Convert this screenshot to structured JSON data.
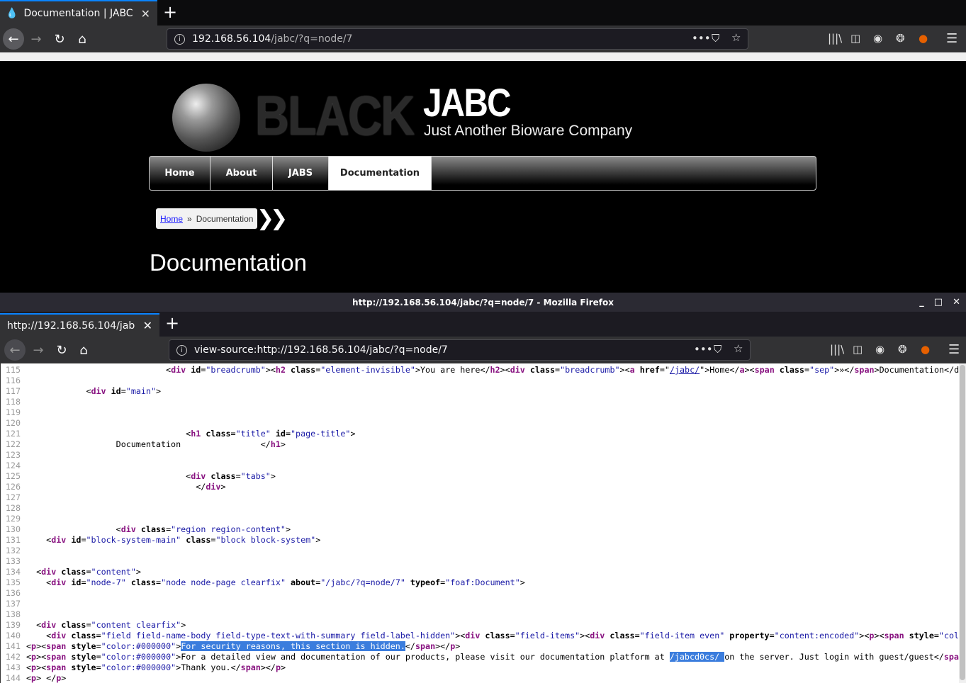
{
  "browser1": {
    "tab_title": "Documentation | JABC",
    "url_host": "192.168.56.104",
    "url_path": "/jabc/?q=node/7"
  },
  "site": {
    "logo_word": "BLACK",
    "name": "JABC",
    "slogan": "Just Another Bioware Company",
    "menu": [
      {
        "label": "Home",
        "active": false
      },
      {
        "label": "About",
        "active": false
      },
      {
        "label": "JABS",
        "active": false
      },
      {
        "label": "Documentation",
        "active": true
      }
    ],
    "breadcrumb": {
      "home": "Home",
      "sep": "»",
      "current": "Documentation"
    },
    "page_title": "Documentation"
  },
  "browser2": {
    "window_title": "http://192.168.56.104/jabc/?q=node/7 - Mozilla Firefox",
    "tab_title": "http://192.168.56.104/jabc/?",
    "url": "view-source:http://192.168.56.104/jabc/?q=node/7"
  },
  "icons": [
    "back-icon",
    "forward-icon",
    "reload-icon",
    "home-icon",
    "info-icon",
    "more-icon",
    "pocket-icon",
    "bookmark-star-icon",
    "library-icon",
    "sidebar-icon",
    "account-icon",
    "cookie-icon",
    "extension-icon",
    "hamburger-menu-icon"
  ],
  "source_lines": [
    {
      "n": "115",
      "tokens": [
        [
          "x",
          "                            <"
        ],
        [
          "t",
          "div"
        ],
        [
          "a",
          " id"
        ],
        [
          "x",
          "="
        ],
        [
          "v",
          "\"breadcrumb\""
        ],
        [
          "x",
          ">"
        ],
        [
          "x",
          "<"
        ],
        [
          "t",
          "h2"
        ],
        [
          "a",
          " class"
        ],
        [
          "x",
          "="
        ],
        [
          "v",
          "\"element-invisible\""
        ],
        [
          "x",
          ">You are here</"
        ],
        [
          "t",
          "h2"
        ],
        [
          "x",
          "><"
        ],
        [
          "t",
          "div"
        ],
        [
          "a",
          " class"
        ],
        [
          "x",
          "="
        ],
        [
          "v",
          "\"breadcrumb\""
        ],
        [
          "x",
          "><"
        ],
        [
          "t",
          "a"
        ],
        [
          "a",
          " href"
        ],
        [
          "x",
          "=\""
        ],
        [
          "l",
          "/jabc/"
        ],
        [
          "x",
          "\">Home</"
        ],
        [
          "t",
          "a"
        ],
        [
          "x",
          "><"
        ],
        [
          "t",
          "span"
        ],
        [
          "a",
          " class"
        ],
        [
          "x",
          "="
        ],
        [
          "v",
          "\"sep\""
        ],
        [
          "x",
          ">»</"
        ],
        [
          "t",
          "span"
        ],
        [
          "x",
          ">Documentation</d"
        ]
      ]
    },
    {
      "n": "116",
      "tokens": []
    },
    {
      "n": "117",
      "tokens": [
        [
          "x",
          "            <"
        ],
        [
          "t",
          "div"
        ],
        [
          "a",
          " id"
        ],
        [
          "x",
          "="
        ],
        [
          "v",
          "\"main\""
        ],
        [
          "x",
          ">"
        ]
      ]
    },
    {
      "n": "118",
      "tokens": []
    },
    {
      "n": "119",
      "tokens": []
    },
    {
      "n": "120",
      "tokens": []
    },
    {
      "n": "121",
      "tokens": [
        [
          "x",
          "                                <"
        ],
        [
          "t",
          "h1"
        ],
        [
          "a",
          " class"
        ],
        [
          "x",
          "="
        ],
        [
          "v",
          "\"title\""
        ],
        [
          "a",
          " id"
        ],
        [
          "x",
          "="
        ],
        [
          "v",
          "\"page-title\""
        ],
        [
          "x",
          ">"
        ]
      ]
    },
    {
      "n": "122",
      "tokens": [
        [
          "x",
          "                  Documentation                </"
        ],
        [
          "t",
          "h1"
        ],
        [
          "x",
          ">"
        ]
      ]
    },
    {
      "n": "123",
      "tokens": []
    },
    {
      "n": "124",
      "tokens": []
    },
    {
      "n": "125",
      "tokens": [
        [
          "x",
          "                                <"
        ],
        [
          "t",
          "div"
        ],
        [
          "a",
          " class"
        ],
        [
          "x",
          "="
        ],
        [
          "v",
          "\"tabs\""
        ],
        [
          "x",
          ">"
        ]
      ]
    },
    {
      "n": "126",
      "tokens": [
        [
          "x",
          "                                  </"
        ],
        [
          "t",
          "div"
        ],
        [
          "x",
          ">"
        ]
      ]
    },
    {
      "n": "127",
      "tokens": []
    },
    {
      "n": "128",
      "tokens": []
    },
    {
      "n": "129",
      "tokens": []
    },
    {
      "n": "130",
      "tokens": [
        [
          "x",
          "                  <"
        ],
        [
          "t",
          "div"
        ],
        [
          "a",
          " class"
        ],
        [
          "x",
          "="
        ],
        [
          "v",
          "\"region region-content\""
        ],
        [
          "x",
          ">"
        ]
      ]
    },
    {
      "n": "131",
      "tokens": [
        [
          "x",
          "    <"
        ],
        [
          "t",
          "div"
        ],
        [
          "a",
          " id"
        ],
        [
          "x",
          "="
        ],
        [
          "v",
          "\"block-system-main\""
        ],
        [
          "a",
          " class"
        ],
        [
          "x",
          "="
        ],
        [
          "v",
          "\"block block-system\""
        ],
        [
          "x",
          ">"
        ]
      ]
    },
    {
      "n": "132",
      "tokens": []
    },
    {
      "n": "133",
      "tokens": []
    },
    {
      "n": "134",
      "tokens": [
        [
          "x",
          "  <"
        ],
        [
          "t",
          "div"
        ],
        [
          "a",
          " class"
        ],
        [
          "x",
          "="
        ],
        [
          "v",
          "\"content\""
        ],
        [
          "x",
          ">"
        ]
      ]
    },
    {
      "n": "135",
      "tokens": [
        [
          "x",
          "    <"
        ],
        [
          "t",
          "div"
        ],
        [
          "a",
          " id"
        ],
        [
          "x",
          "="
        ],
        [
          "v",
          "\"node-7\""
        ],
        [
          "a",
          " class"
        ],
        [
          "x",
          "="
        ],
        [
          "v",
          "\"node node-page clearfix\""
        ],
        [
          "a",
          " about"
        ],
        [
          "x",
          "="
        ],
        [
          "v",
          "\"/jabc/?q=node/7\""
        ],
        [
          "a",
          " typeof"
        ],
        [
          "x",
          "="
        ],
        [
          "v",
          "\"foaf:Document\""
        ],
        [
          "x",
          ">"
        ]
      ]
    },
    {
      "n": "136",
      "tokens": []
    },
    {
      "n": "137",
      "tokens": []
    },
    {
      "n": "138",
      "tokens": []
    },
    {
      "n": "139",
      "tokens": [
        [
          "x",
          "  <"
        ],
        [
          "t",
          "div"
        ],
        [
          "a",
          " class"
        ],
        [
          "x",
          "="
        ],
        [
          "v",
          "\"content clearfix\""
        ],
        [
          "x",
          ">"
        ]
      ]
    },
    {
      "n": "140",
      "tokens": [
        [
          "x",
          "    <"
        ],
        [
          "t",
          "div"
        ],
        [
          "a",
          " class"
        ],
        [
          "x",
          "="
        ],
        [
          "v",
          "\"field field-name-body field-type-text-with-summary field-label-hidden\""
        ],
        [
          "x",
          "><"
        ],
        [
          "t",
          "div"
        ],
        [
          "a",
          " class"
        ],
        [
          "x",
          "="
        ],
        [
          "v",
          "\"field-items\""
        ],
        [
          "x",
          "><"
        ],
        [
          "t",
          "div"
        ],
        [
          "a",
          " class"
        ],
        [
          "x",
          "="
        ],
        [
          "v",
          "\"field-item even\""
        ],
        [
          "a",
          " property"
        ],
        [
          "x",
          "="
        ],
        [
          "v",
          "\"content:encoded\""
        ],
        [
          "x",
          "><"
        ],
        [
          "t",
          "p"
        ],
        [
          "x",
          "><"
        ],
        [
          "t",
          "span"
        ],
        [
          "a",
          " style"
        ],
        [
          "x",
          "="
        ],
        [
          "v",
          "\"col"
        ]
      ]
    },
    {
      "n": "141",
      "tokens": [
        [
          "x",
          "<"
        ],
        [
          "t",
          "p"
        ],
        [
          "x",
          "><"
        ],
        [
          "t",
          "span"
        ],
        [
          "a",
          " style"
        ],
        [
          "x",
          "="
        ],
        [
          "v",
          "\"color:#000000\""
        ],
        [
          "x",
          ">"
        ],
        [
          "h",
          "For security reasons, this section is hidden."
        ],
        [
          "x",
          "</"
        ],
        [
          "t",
          "span"
        ],
        [
          "x",
          "></"
        ],
        [
          "t",
          "p"
        ],
        [
          "x",
          ">"
        ]
      ]
    },
    {
      "n": "142",
      "tokens": [
        [
          "x",
          "<"
        ],
        [
          "t",
          "p"
        ],
        [
          "x",
          "><"
        ],
        [
          "t",
          "span"
        ],
        [
          "a",
          " style"
        ],
        [
          "x",
          "="
        ],
        [
          "v",
          "\"color:#000000\""
        ],
        [
          "x",
          ">For a detailed view and documentation of our products, please visit our documentation platform at "
        ],
        [
          "h",
          "/jabcd0cs/ "
        ],
        [
          "x",
          "on the server. Just login with guest/guest</"
        ],
        [
          "t",
          "spa"
        ]
      ]
    },
    {
      "n": "143",
      "tokens": [
        [
          "x",
          "<"
        ],
        [
          "t",
          "p"
        ],
        [
          "x",
          "><"
        ],
        [
          "t",
          "span"
        ],
        [
          "a",
          " style"
        ],
        [
          "x",
          "="
        ],
        [
          "v",
          "\"color:#000000\""
        ],
        [
          "x",
          ">Thank you.</"
        ],
        [
          "t",
          "span"
        ],
        [
          "x",
          "></"
        ],
        [
          "t",
          "p"
        ],
        [
          "x",
          ">"
        ]
      ]
    },
    {
      "n": "144",
      "tokens": [
        [
          "x",
          "<"
        ],
        [
          "t",
          "p"
        ],
        [
          "x",
          "> </"
        ],
        [
          "t",
          "p"
        ],
        [
          "x",
          ">"
        ]
      ]
    }
  ]
}
